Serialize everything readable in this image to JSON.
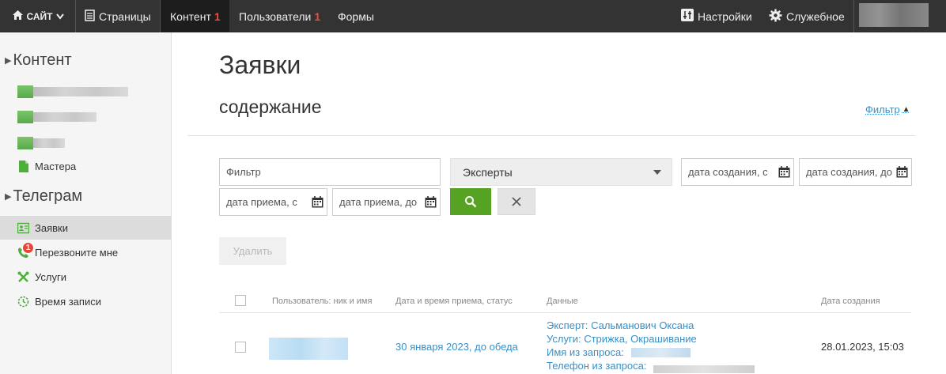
{
  "topbar": {
    "site_label": "САЙТ",
    "pages_label": "Страницы",
    "content_label": "Контент",
    "content_count": "1",
    "users_label": "Пользователи",
    "users_count": "1",
    "forms_label": "Формы",
    "settings_label": "Настройки",
    "service_label": "Служебное"
  },
  "sidebar": {
    "content_section": "Контент",
    "masters_label": "Мастера",
    "telegram_section": "Телеграм",
    "items": [
      {
        "label": "Заявки"
      },
      {
        "label": "Перезвоните мне",
        "badge": "1"
      },
      {
        "label": "Услуги"
      },
      {
        "label": "Время записи"
      }
    ]
  },
  "main": {
    "title": "Заявки",
    "subtitle": "содержание",
    "filter_link": "Фильтр",
    "filters": {
      "text_placeholder": "Фильтр",
      "expert_select": "Эксперты",
      "created_from": "дата создания, с",
      "created_to": "дата создания, до",
      "appt_from": "дата приема, с",
      "appt_to": "дата приема, до"
    },
    "delete_label": "Удалить",
    "table": {
      "headers": [
        "Пользователь: ник и имя",
        "Дата и время приема, статус",
        "Данные",
        "Дата создания"
      ],
      "rows": [
        {
          "appointment": "30 января 2023, до обеда",
          "data_expert": "Эксперт: Сальманович Оксана",
          "data_services": "Услуги: Стрижка, Окрашивание",
          "data_name": "Имя из запроса:",
          "data_phone": "Телефон из запроса:",
          "created": "28.01.2023, 15:03"
        }
      ]
    }
  },
  "colors": {
    "accent_green": "#56a324",
    "link_blue": "#3b8fc4",
    "badge_red": "#e8453c"
  }
}
